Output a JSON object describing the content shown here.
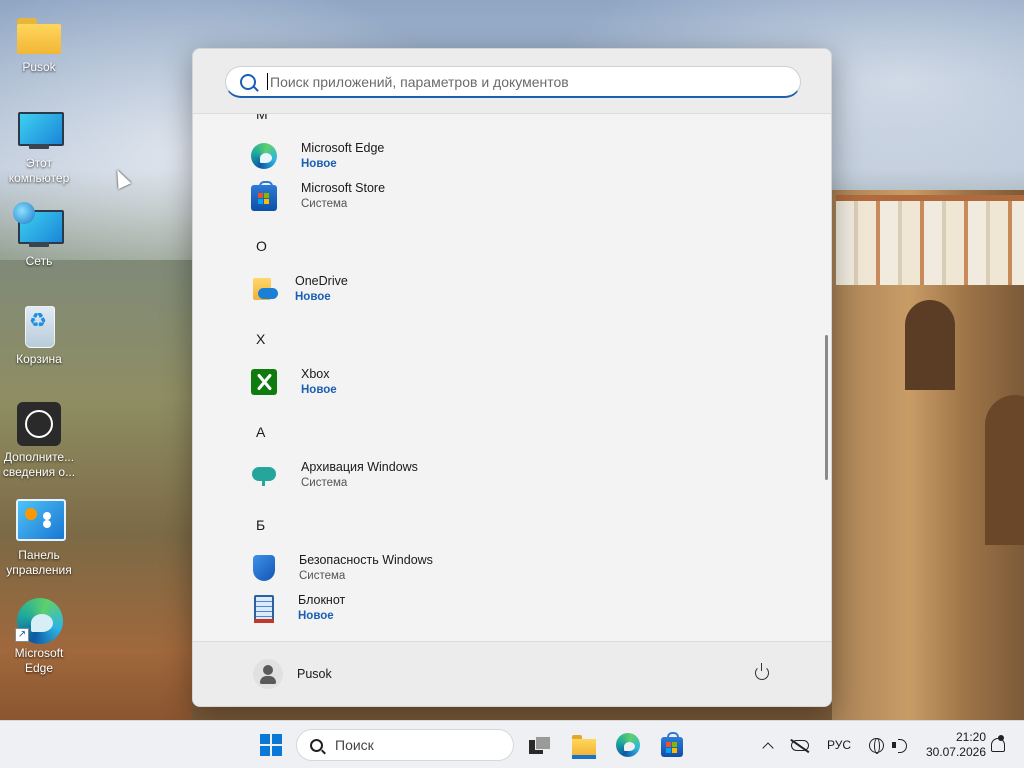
{
  "desktop": {
    "icons": [
      {
        "label": "Pusok",
        "icon": "folder-icon"
      },
      {
        "label": "Этот компьютер",
        "icon": "this-pc-icon"
      },
      {
        "label": "Сеть",
        "icon": "network-icon"
      },
      {
        "label": "Корзина",
        "icon": "recycle-bin-icon"
      },
      {
        "label": "Дополните... сведения о...",
        "icon": "info-icon"
      },
      {
        "label": "Панель управления",
        "icon": "control-panel-icon"
      },
      {
        "label": "Microsoft Edge",
        "icon": "edge-icon"
      }
    ]
  },
  "start_menu": {
    "search_placeholder": "Поиск приложений, параметров и документов",
    "partial_letter": "M",
    "groups": [
      {
        "letter": "O"
      },
      {
        "letter": "X"
      },
      {
        "letter": "А"
      },
      {
        "letter": "Б"
      }
    ],
    "apps": [
      {
        "name": "Microsoft Edge",
        "status": "Новое",
        "icon": "edge-icon"
      },
      {
        "name": "Microsoft Store",
        "status": "Система",
        "icon": "store-icon"
      },
      {
        "name": "OneDrive",
        "status": "Новое",
        "icon": "onedrive-icon"
      },
      {
        "name": "Xbox",
        "status": "Новое",
        "icon": "xbox-icon"
      },
      {
        "name": "Архивация Windows",
        "status": "Система",
        "icon": "backup-icon"
      },
      {
        "name": "Безопасность Windows",
        "status": "Система",
        "icon": "shield-icon"
      },
      {
        "name": "Блокнот",
        "status": "Новое",
        "icon": "notepad-icon"
      }
    ],
    "footer": {
      "user_name": "Pusok",
      "power_icon": "power-icon"
    }
  },
  "taskbar": {
    "search_label": "Поиск",
    "language": "РУС",
    "time": "21:20",
    "date": "30.07.2026"
  },
  "colors": {
    "accent": "#1a5fb4",
    "new_status": "#1a5fb4",
    "start_bg": "#f3f3f3"
  }
}
